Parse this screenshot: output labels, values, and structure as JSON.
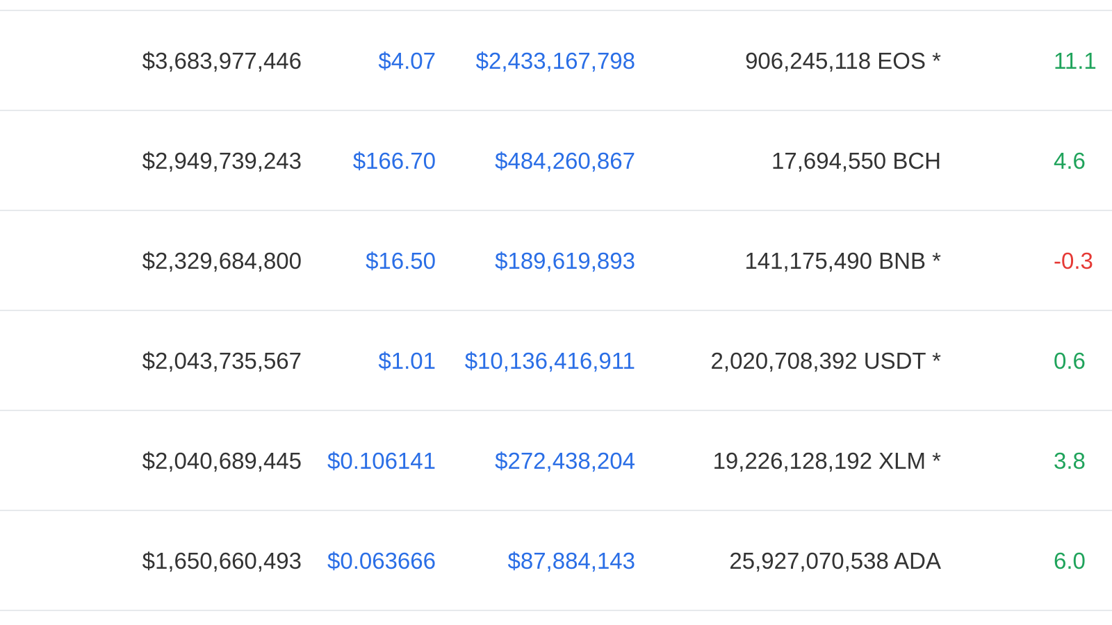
{
  "table": {
    "rows": [
      {
        "market_cap": "$3,683,977,446",
        "price": "$4.07",
        "volume": "$2,433,167,798",
        "supply": "906,245,118 EOS *",
        "change": "11.1",
        "change_direction": "positive"
      },
      {
        "market_cap": "$2,949,739,243",
        "price": "$166.70",
        "volume": "$484,260,867",
        "supply": "17,694,550 BCH",
        "change": "4.6",
        "change_direction": "positive"
      },
      {
        "market_cap": "$2,329,684,800",
        "price": "$16.50",
        "volume": "$189,619,893",
        "supply": "141,175,490 BNB *",
        "change": "-0.3",
        "change_direction": "negative"
      },
      {
        "market_cap": "$2,043,735,567",
        "price": "$1.01",
        "volume": "$10,136,416,911",
        "supply": "2,020,708,392 USDT *",
        "change": "0.6",
        "change_direction": "positive"
      },
      {
        "market_cap": "$2,040,689,445",
        "price": "$0.106141",
        "volume": "$272,438,204",
        "supply": "19,226,128,192 XLM *",
        "change": "3.8",
        "change_direction": "positive"
      },
      {
        "market_cap": "$1,650,660,493",
        "price": "$0.063666",
        "volume": "$87,884,143",
        "supply": "25,927,070,538 ADA",
        "change": "6.0",
        "change_direction": "positive"
      }
    ]
  },
  "colors": {
    "text": "#333333",
    "link": "#2a6ee6",
    "positive": "#1fa35b",
    "negative": "#e53935",
    "divider": "#e6e9ec"
  }
}
